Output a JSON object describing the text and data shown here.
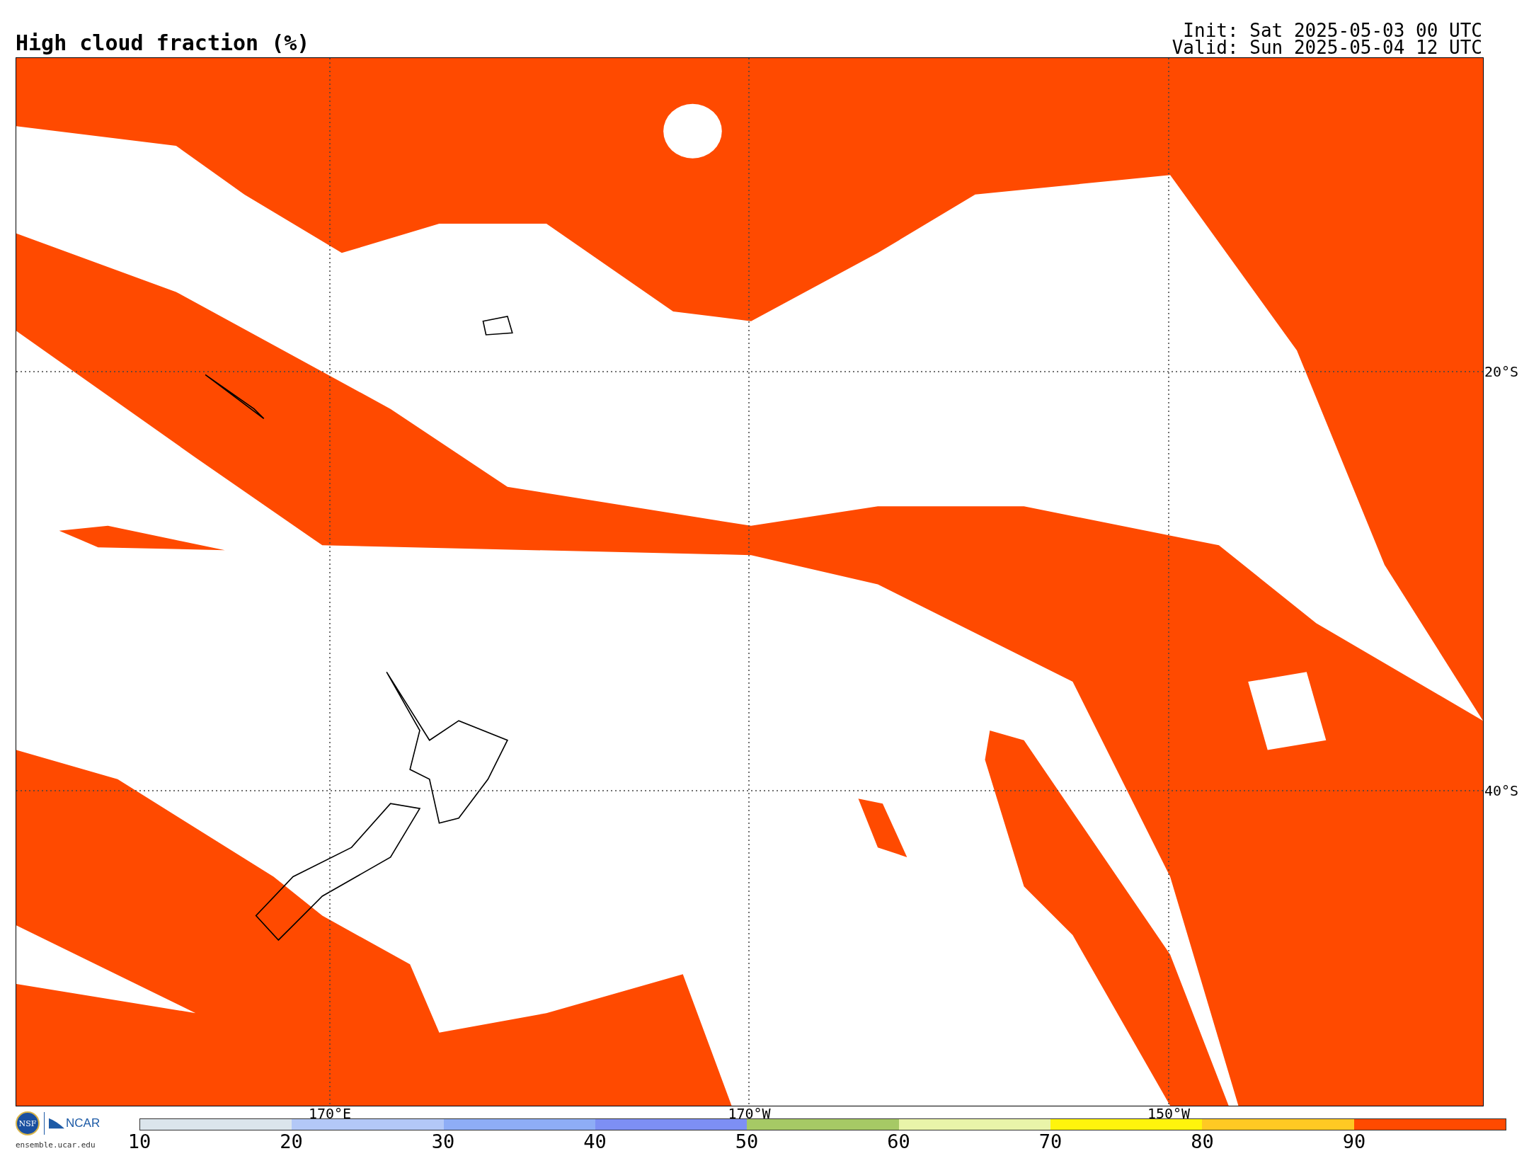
{
  "title": "High cloud fraction (%)",
  "init": "Init: Sat 2025-05-03 00 UTC",
  "valid": "Valid: Sun 2025-05-04 12 UTC",
  "map": {
    "lon_labels": [
      "170°E",
      "170°W",
      "150°W"
    ],
    "lat_labels": [
      "20°S",
      "40°S"
    ]
  },
  "colorbar": {
    "ticks": [
      "10",
      "20",
      "30",
      "40",
      "50",
      "60",
      "70",
      "80",
      "90"
    ],
    "bins": [
      {
        "color": "#dbe5ec"
      },
      {
        "color": "#b3c8f7"
      },
      {
        "color": "#8eadf6"
      },
      {
        "color": "#7d8ff4"
      },
      {
        "color": "#a6c965"
      },
      {
        "color": "#e9f4a9"
      },
      {
        "color": "#fff40c"
      },
      {
        "color": "#ffc923"
      },
      {
        "color": "#ff4a00"
      }
    ]
  },
  "logos": {
    "nsf": "NSF",
    "ncar": "NCAR",
    "url": "ensemble.ucar.edu"
  }
}
